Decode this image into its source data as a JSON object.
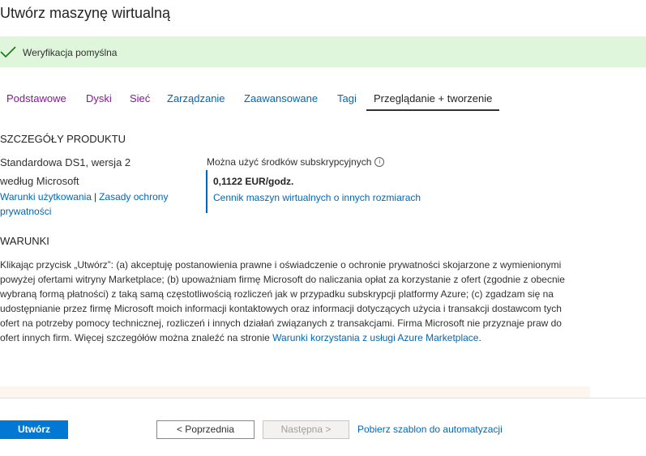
{
  "title": "Utwórz maszynę wirtualną",
  "banner": {
    "message": "Weryfikacja pomyślna",
    "icon": "checkmark-icon",
    "color": "#dff6dd"
  },
  "tabs": [
    {
      "label": "Podstawowe",
      "state": "visited"
    },
    {
      "label": "Dyski",
      "state": "visited"
    },
    {
      "label": "Sieć",
      "state": "visited"
    },
    {
      "label": "Zarządzanie",
      "state": "link"
    },
    {
      "label": "Zaawansowane",
      "state": "link"
    },
    {
      "label": "Tagi",
      "state": "link"
    },
    {
      "label": "Przeglądanie + tworzenie",
      "state": "active"
    }
  ],
  "product": {
    "section_title": "SZCZEGÓŁY PRODUKTU",
    "name": "Standardowa DS1, wersja 2",
    "publisher": "według Microsoft",
    "terms_link": "Warunki użytkowania",
    "separator": "|",
    "privacy_link": "Zasady ochrony prywatności",
    "credits_label": "Można użyć środków subskrypcyjnych",
    "info_icon": "info-icon",
    "price": "0,1122 EUR/godz.",
    "pricing_link": "Cennik maszyn wirtualnych o innych rozmiarach"
  },
  "terms": {
    "section_title": "WARUNKI",
    "body": "Klikając przycisk „Utwórz”: (a) akceptuję postanowienia prawne i oświadczenie o ochronie prywatności skojarzone z wymienionymi powyżej ofertami witryny Marketplace; (b) upoważniam firmę Microsoft do naliczania opłat za korzystanie z ofert (zgodnie z obecnie wybraną formą płatności) z taką samą częstotliwością rozliczeń jak w przypadku subskrypcji platformy Azure; (c) zgadzam się na udostępnianie przez firmę Microsoft moich informacji kontaktowych oraz informacji dotyczących użycia i transakcji dostawcom tych ofert na potrzeby pomocy technicznej, rozliczeń i innych działań związanych z transakcjami. Firma Microsoft nie przyznaje praw do ofert innych firm. Więcej szczegółów można znaleźć na stronie ",
    "link": "Warunki korzystania z usługi Azure Marketplace",
    "end": "."
  },
  "footer": {
    "create_label": "Utwórz",
    "previous_label": "< Poprzednia",
    "next_label": "Następna >",
    "download_label": "Pobierz szablon do automatyzacji"
  },
  "colors": {
    "accent": "#0078d4",
    "link": "#0067b8",
    "visited": "#881798",
    "success": "#107c10"
  }
}
